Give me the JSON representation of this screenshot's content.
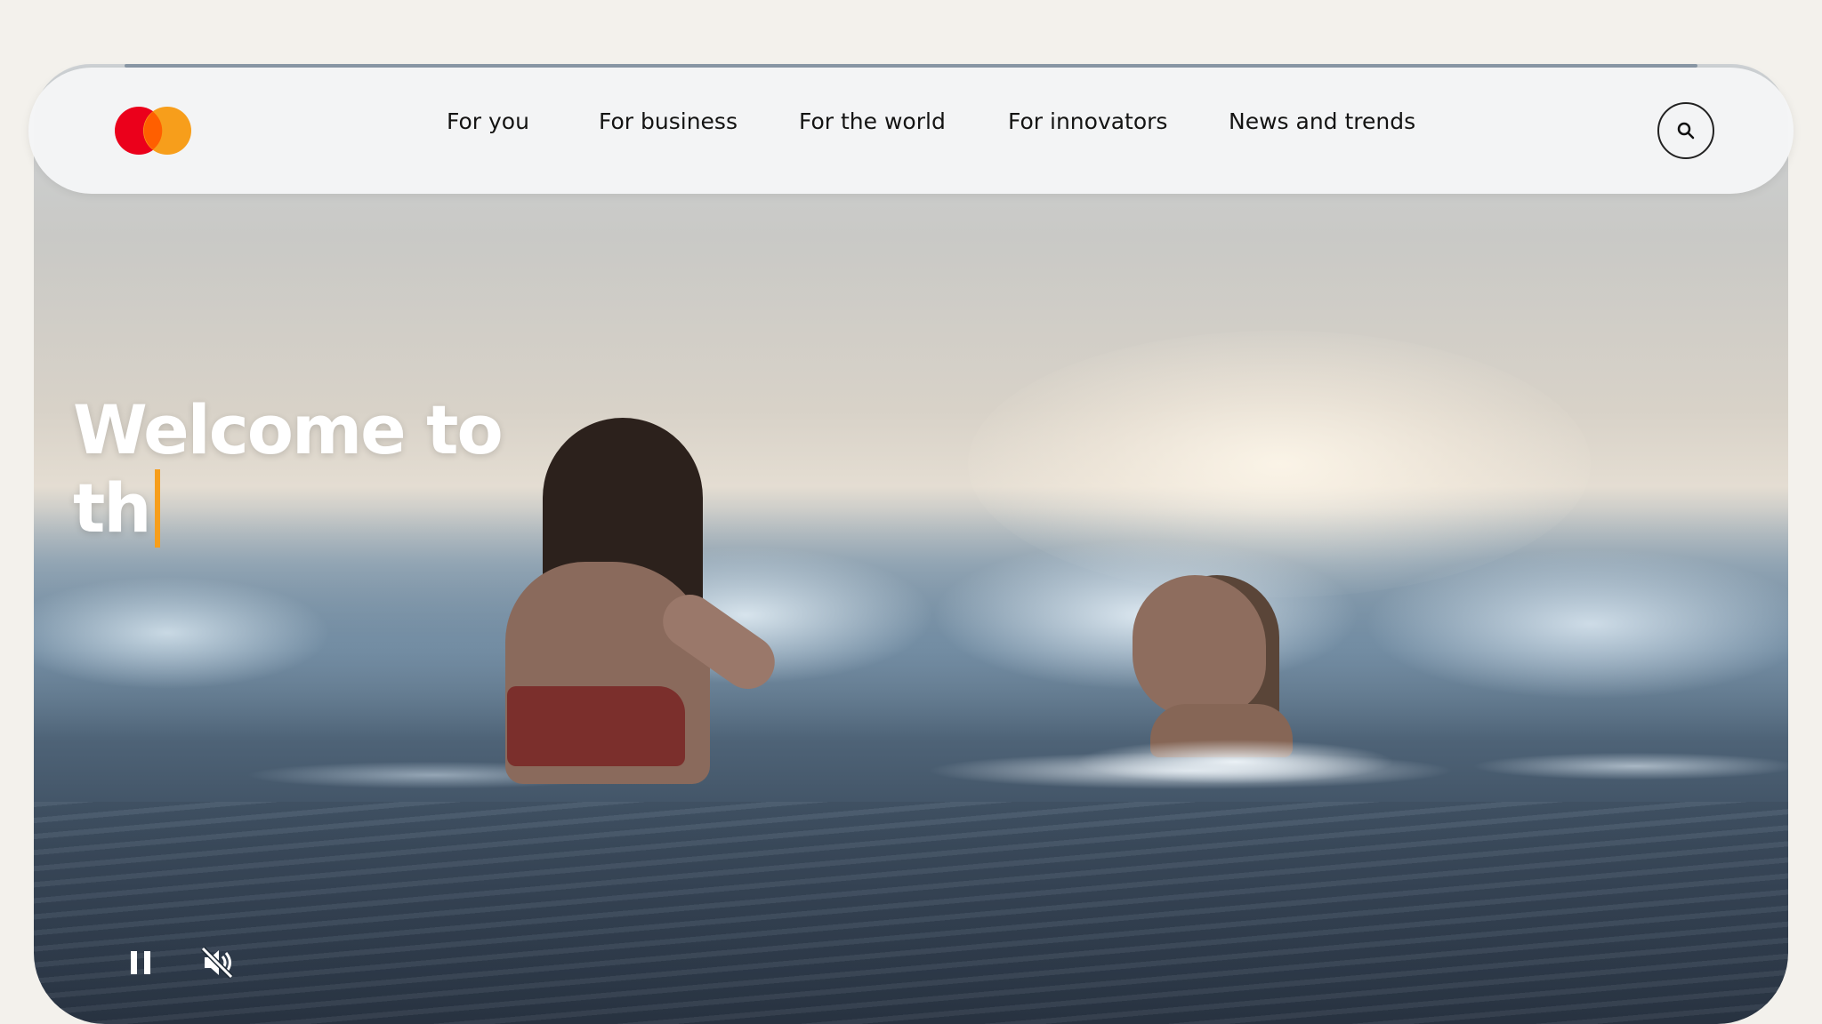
{
  "brand": {
    "logo_icon": "mastercard-logo-icon",
    "colors": {
      "red": "#eb001b",
      "yellow": "#f79e1b",
      "overlap": "#ff5f00"
    }
  },
  "nav": {
    "items": [
      {
        "label": "For you"
      },
      {
        "label": "For business"
      },
      {
        "label": "For the world"
      },
      {
        "label": "For innovators"
      },
      {
        "label": "News and trends"
      }
    ],
    "search_icon": "search-icon"
  },
  "hero": {
    "headline_line1": "Welcome to",
    "headline_line2": "th",
    "cursor_color": "#f79e1b",
    "controls": {
      "pause_icon": "pause-icon",
      "mute_icon": "muted-speaker-icon"
    }
  }
}
